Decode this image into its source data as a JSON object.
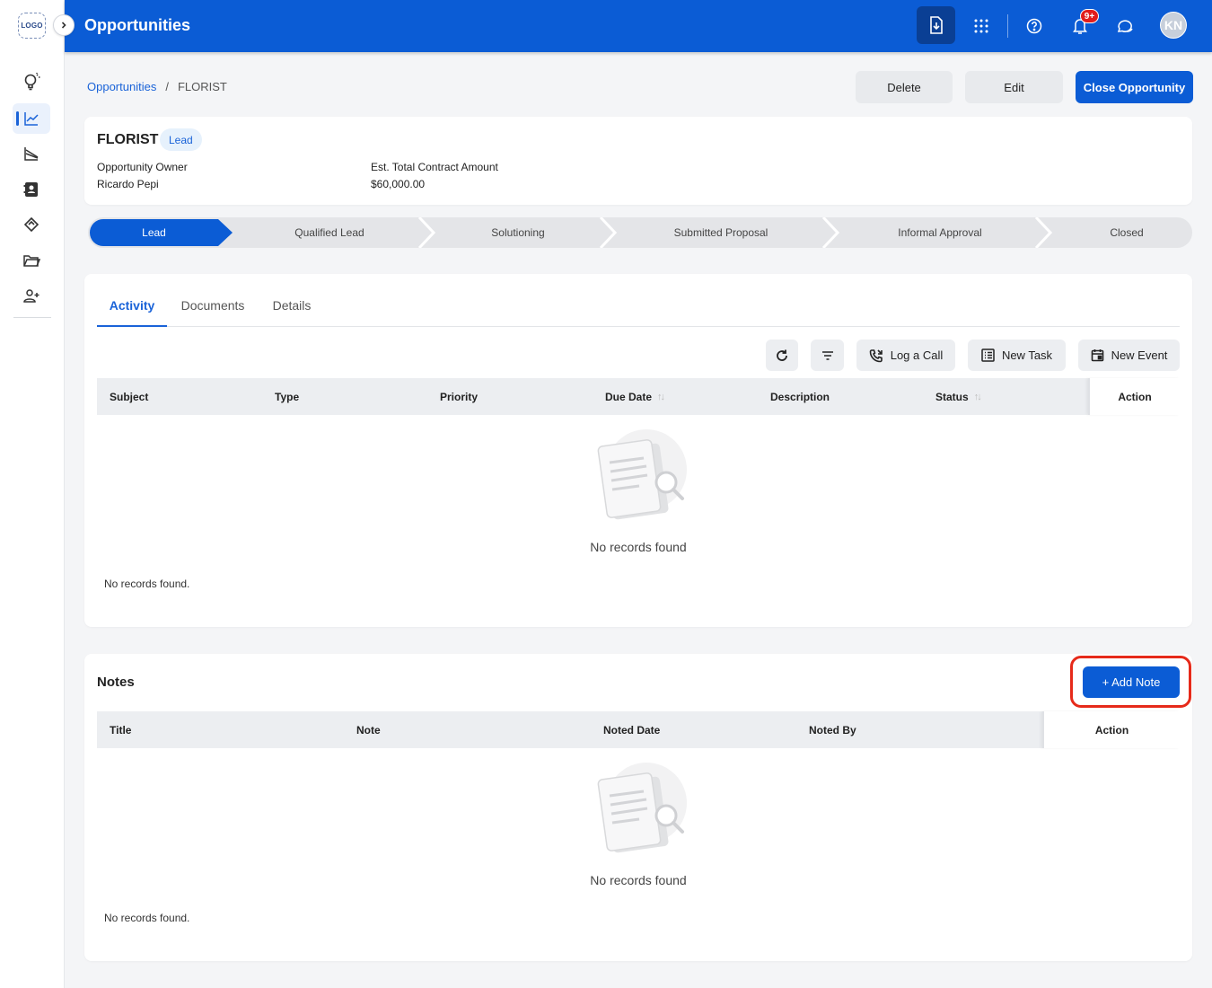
{
  "app": {
    "logo_text": "LOGO",
    "page_title": "Opportunities",
    "notification_count": "9+",
    "avatar_initials": "KN"
  },
  "sidebar": {
    "items": [
      {
        "icon": "lightbulb-icon"
      },
      {
        "icon": "trend-chart-icon",
        "active": true
      },
      {
        "icon": "forecast-chart-icon"
      },
      {
        "icon": "contacts-icon"
      },
      {
        "icon": "handshake-icon"
      },
      {
        "icon": "folder-icon"
      },
      {
        "icon": "add-user-icon"
      }
    ]
  },
  "breadcrumb": {
    "parent": "Opportunities",
    "separator": "/",
    "current": "FLORIST"
  },
  "actions": {
    "delete": "Delete",
    "edit": "Edit",
    "close": "Close Opportunity"
  },
  "opportunity": {
    "name": "FLORIST",
    "stage_tag": "Lead",
    "owner_label": "Opportunity Owner",
    "owner_value": "Ricardo Pepi",
    "amount_label": "Est. Total Contract Amount",
    "amount_value": "$60,000.00"
  },
  "stages": [
    "Lead",
    "Qualified Lead",
    "Solutioning",
    "Submitted Proposal",
    "Informal Approval",
    "Closed"
  ],
  "tabs": [
    "Activity",
    "Documents",
    "Details"
  ],
  "activity": {
    "toolbar": {
      "log_call": "Log a Call",
      "new_task": "New Task",
      "new_event": "New Event"
    },
    "columns": [
      "Subject",
      "Type",
      "Priority",
      "Due Date",
      "Description",
      "Status",
      "Action"
    ],
    "empty_message": "No records found",
    "footer": "No records found."
  },
  "notes": {
    "title": "Notes",
    "add_button": "+ Add Note",
    "columns": [
      "Title",
      "Note",
      "Noted Date",
      "Noted By",
      "Action"
    ],
    "empty_message": "No records found",
    "footer": "No records found."
  },
  "colors": {
    "primary": "#0b5cd5",
    "highlight": "#e62a1a"
  }
}
